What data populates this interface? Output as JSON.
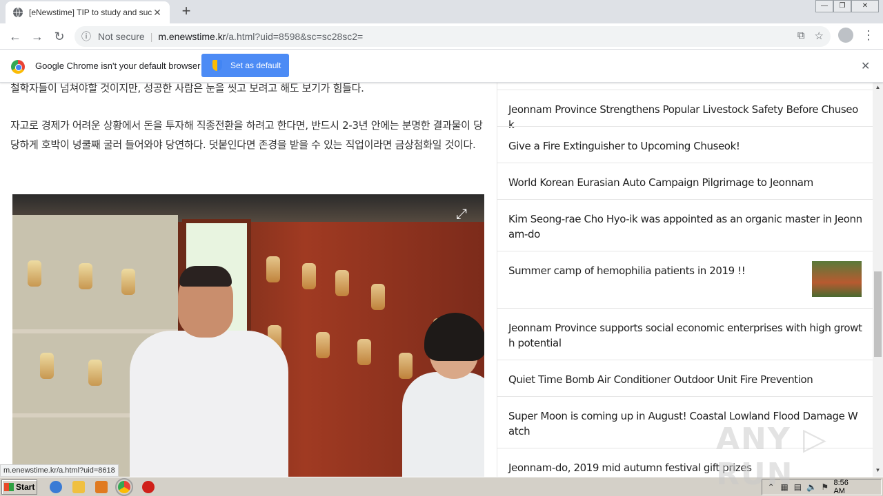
{
  "browser": {
    "tab_title": "[eNewstime] TIP to study and succe",
    "tab_close": "✕",
    "new_tab": "+",
    "window_controls": [
      "—",
      "❐",
      "✕"
    ],
    "nav_back": "←",
    "nav_forward": "→",
    "nav_reload": "↻",
    "security": "Not secure",
    "url_host": "m.enewstime.kr",
    "url_path": "/a.html?uid=8598&sc=sc28sc2=",
    "menu": "⋮"
  },
  "infobar": {
    "message": "Google Chrome isn't your default browser",
    "button": "Set as default",
    "close": "✕"
  },
  "article": {
    "p1": "철학자들이 넘쳐야할 것이지만, 성공한 사람은 눈을 씻고 보려고 해도 보기가 힘들다.",
    "p2": "자고로 경제가 어려운 상황에서 돈을 투자해 직종전환을 하려고 한다면, 반드시 2-3년 안에는 분명한 결과물이 당당하게 호박이 넝쿨째 굴러 들어와야 당연하다. 덧붙인다면 존경을 받을 수 있는 직업이라면 금상첨화일 것이다.",
    "expand": "⤢"
  },
  "sidebar": {
    "items": [
      {
        "title": "Jeonnam Province Strengthens Popular Livestock Safety Before Chuseok"
      },
      {
        "title": "Give a Fire Extinguisher to Upcoming Chuseok!"
      },
      {
        "title": "World Korean Eurasian Auto Campaign Pilgrimage to Jeonnam"
      },
      {
        "title": "Kim Seong-rae Cho Hyo-ik was appointed as an organic master in Jeonnam-do"
      },
      {
        "title": "Summer camp of hemophilia patients in 2019 !!"
      },
      {
        "title": "Jeonnam Province supports social economic enterprises with high growth potential"
      },
      {
        "title": "Quiet Time Bomb Air Conditioner Outdoor Unit Fire Prevention"
      },
      {
        "title": "Super Moon is coming up in August! Coastal Lowland Flood Damage Watch"
      },
      {
        "title": "Jeonnam-do, 2019 mid autumn festival gift prizes"
      }
    ]
  },
  "status_url": "m.enewstime.kr/a.html?uid=8618",
  "watermark": "ANY ▷ RUN",
  "taskbar": {
    "start": "Start",
    "clock": "8:56 AM"
  }
}
